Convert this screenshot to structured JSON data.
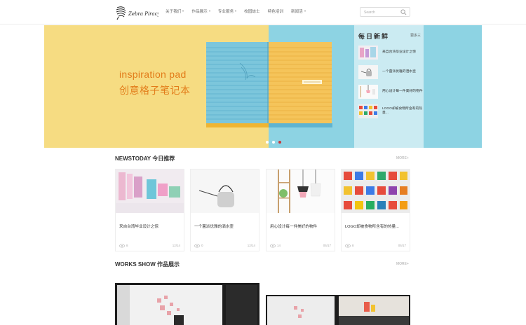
{
  "header": {
    "logo_text": "Zebra Piracy",
    "nav": [
      {
        "label": "关于我们",
        "caret": true
      },
      {
        "label": "作品展示",
        "caret": true
      },
      {
        "label": "专业服务",
        "caret": true
      },
      {
        "label": "校园誌士",
        "caret": false
      },
      {
        "label": "特色培训",
        "caret": false
      },
      {
        "label": "新闻活",
        "caret": true
      }
    ],
    "search": {
      "placeholder": "Search"
    }
  },
  "banner": {
    "title_en": "inspiration pad",
    "title_cn": "创意格子笔记本",
    "slides": 3,
    "active_slide": 3,
    "colors": {
      "left": "#f6dc82",
      "right": "#8dd3e3",
      "accent": "#e27b19"
    }
  },
  "daily_fresh": {
    "title": "每日新鲜",
    "more": "更多三",
    "items": [
      {
        "text": "来自台湾毕业设计之惊"
      },
      {
        "text": "一个菌派优雅的洒水壶"
      },
      {
        "text": "用心设计每一件美好的物件"
      },
      {
        "text": "LOGO却被食物所含有的热量..."
      }
    ]
  },
  "news_today": {
    "title": "NEWSTODAY 今日推荐",
    "more": "MORE+",
    "cards": [
      {
        "title": "来自台湾毕业设计之惊",
        "views": "8",
        "date": "12/14"
      },
      {
        "title": "一个菌派优雅的洒水壶",
        "views": "0",
        "date": "12/14"
      },
      {
        "title": "用心设计每一件美好的物件",
        "views": "14",
        "date": "05/17"
      },
      {
        "title": "LOGO却被食物所含有的热量...",
        "views": "8",
        "date": "05/17"
      }
    ]
  },
  "works_show": {
    "title": "WORKS SHOW 作品展示",
    "more": "MORE+"
  }
}
